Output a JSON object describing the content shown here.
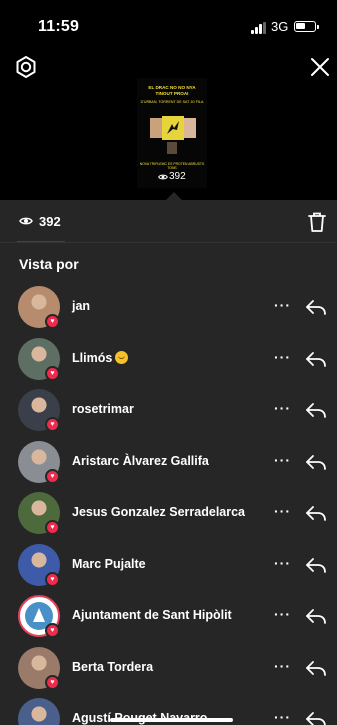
{
  "status_bar": {
    "time": "11:59",
    "network": "3G"
  },
  "story_preview": {
    "line1": "EL DRAC NO NO NYA",
    "line2": "TINOUT PROAI",
    "line3": "D'URBAN, TORRENT DE SAT JO FILA",
    "line4": "NOVA TRIPLEMC ES PROTEN ABRUSTS TONS",
    "view_count": "392"
  },
  "sheet": {
    "view_count": "392",
    "section_title": "Vista por",
    "viewers": [
      {
        "name": "jan",
        "emoji": false,
        "avatar_color": "#b78b6e"
      },
      {
        "name": "Llimós",
        "emoji": true,
        "avatar_color": "#5d6f63"
      },
      {
        "name": "rosetrimar",
        "emoji": false,
        "avatar_color": "#3b3f49"
      },
      {
        "name": "Aristarc Àlvarez Gallifa",
        "emoji": false,
        "avatar_color": "#8a8d93"
      },
      {
        "name": "Jesus Gonzalez Serradelarca",
        "emoji": false,
        "avatar_color": "#4d6a3d"
      },
      {
        "name": "Marc Pujalte",
        "emoji": false,
        "avatar_color": "#3d5ba8"
      },
      {
        "name": "Ajuntament de Sant Hipòlit",
        "emoji": false,
        "avatar_color": "#ffffff"
      },
      {
        "name": "Berta Tordera",
        "emoji": false,
        "avatar_color": "#9a7b6a"
      },
      {
        "name": "Agustí Pouget Navarro",
        "emoji": false,
        "avatar_color": "#4a5f8c"
      }
    ],
    "more_label": "···"
  },
  "colors": {
    "sheet_bg": "#262626",
    "heart": "#ed2b4c",
    "accent_ring": "#e4405f"
  }
}
